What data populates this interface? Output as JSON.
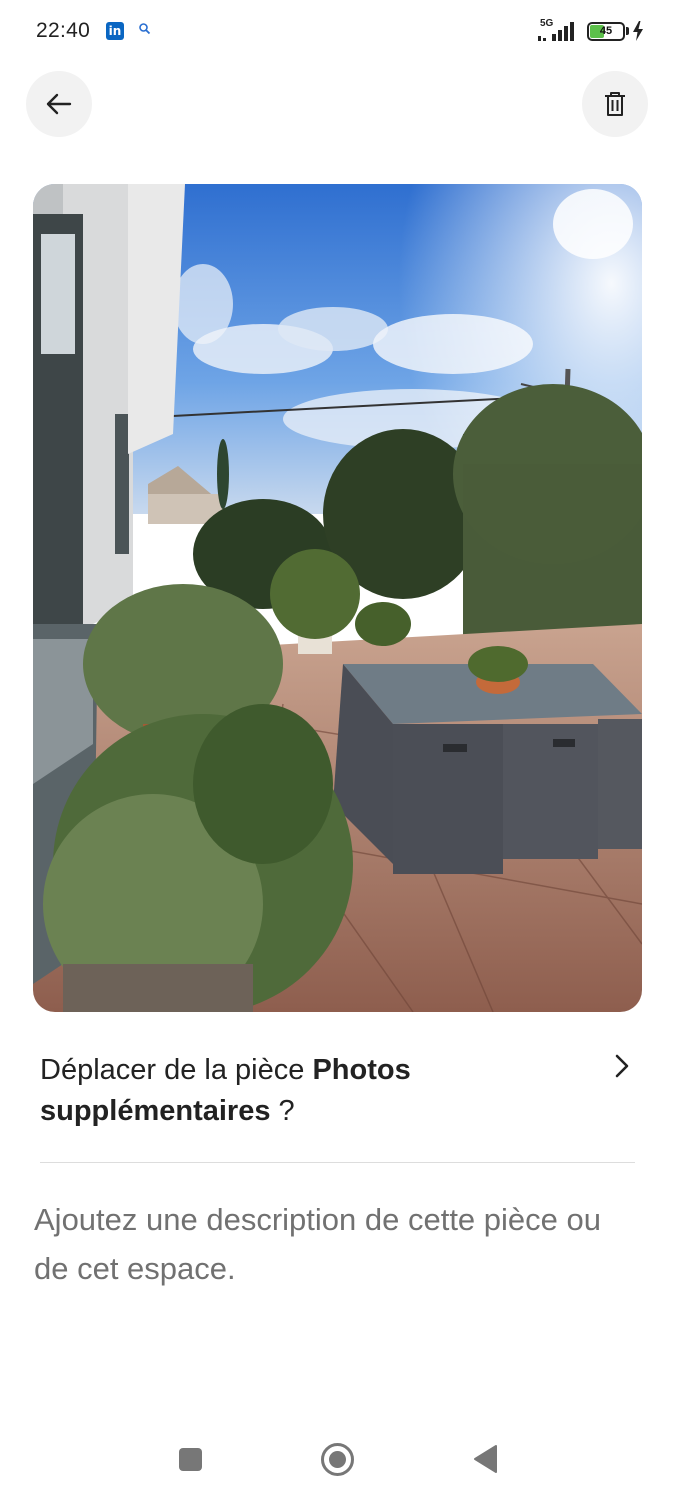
{
  "status_bar": {
    "time": "22:40",
    "linkedin_icon": "in",
    "network": "5G",
    "battery": "45",
    "battery_level": 0.45
  },
  "header": {
    "back_icon": "arrow-left-icon",
    "delete_icon": "trash-icon"
  },
  "photo": {
    "description": "outdoor terrace with potted plants and wicker furniture"
  },
  "move_room": {
    "prefix": "Déplacer de la pièce ",
    "room_name": "Photos supplémentaires",
    "suffix": " ?"
  },
  "description": {
    "placeholder": "Ajoutez une description de cette pièce ou de cet espace."
  },
  "nav_bar": {
    "recent_icon": "square-icon",
    "home_icon": "circle-home-icon",
    "back_icon": "triangle-back-icon"
  }
}
